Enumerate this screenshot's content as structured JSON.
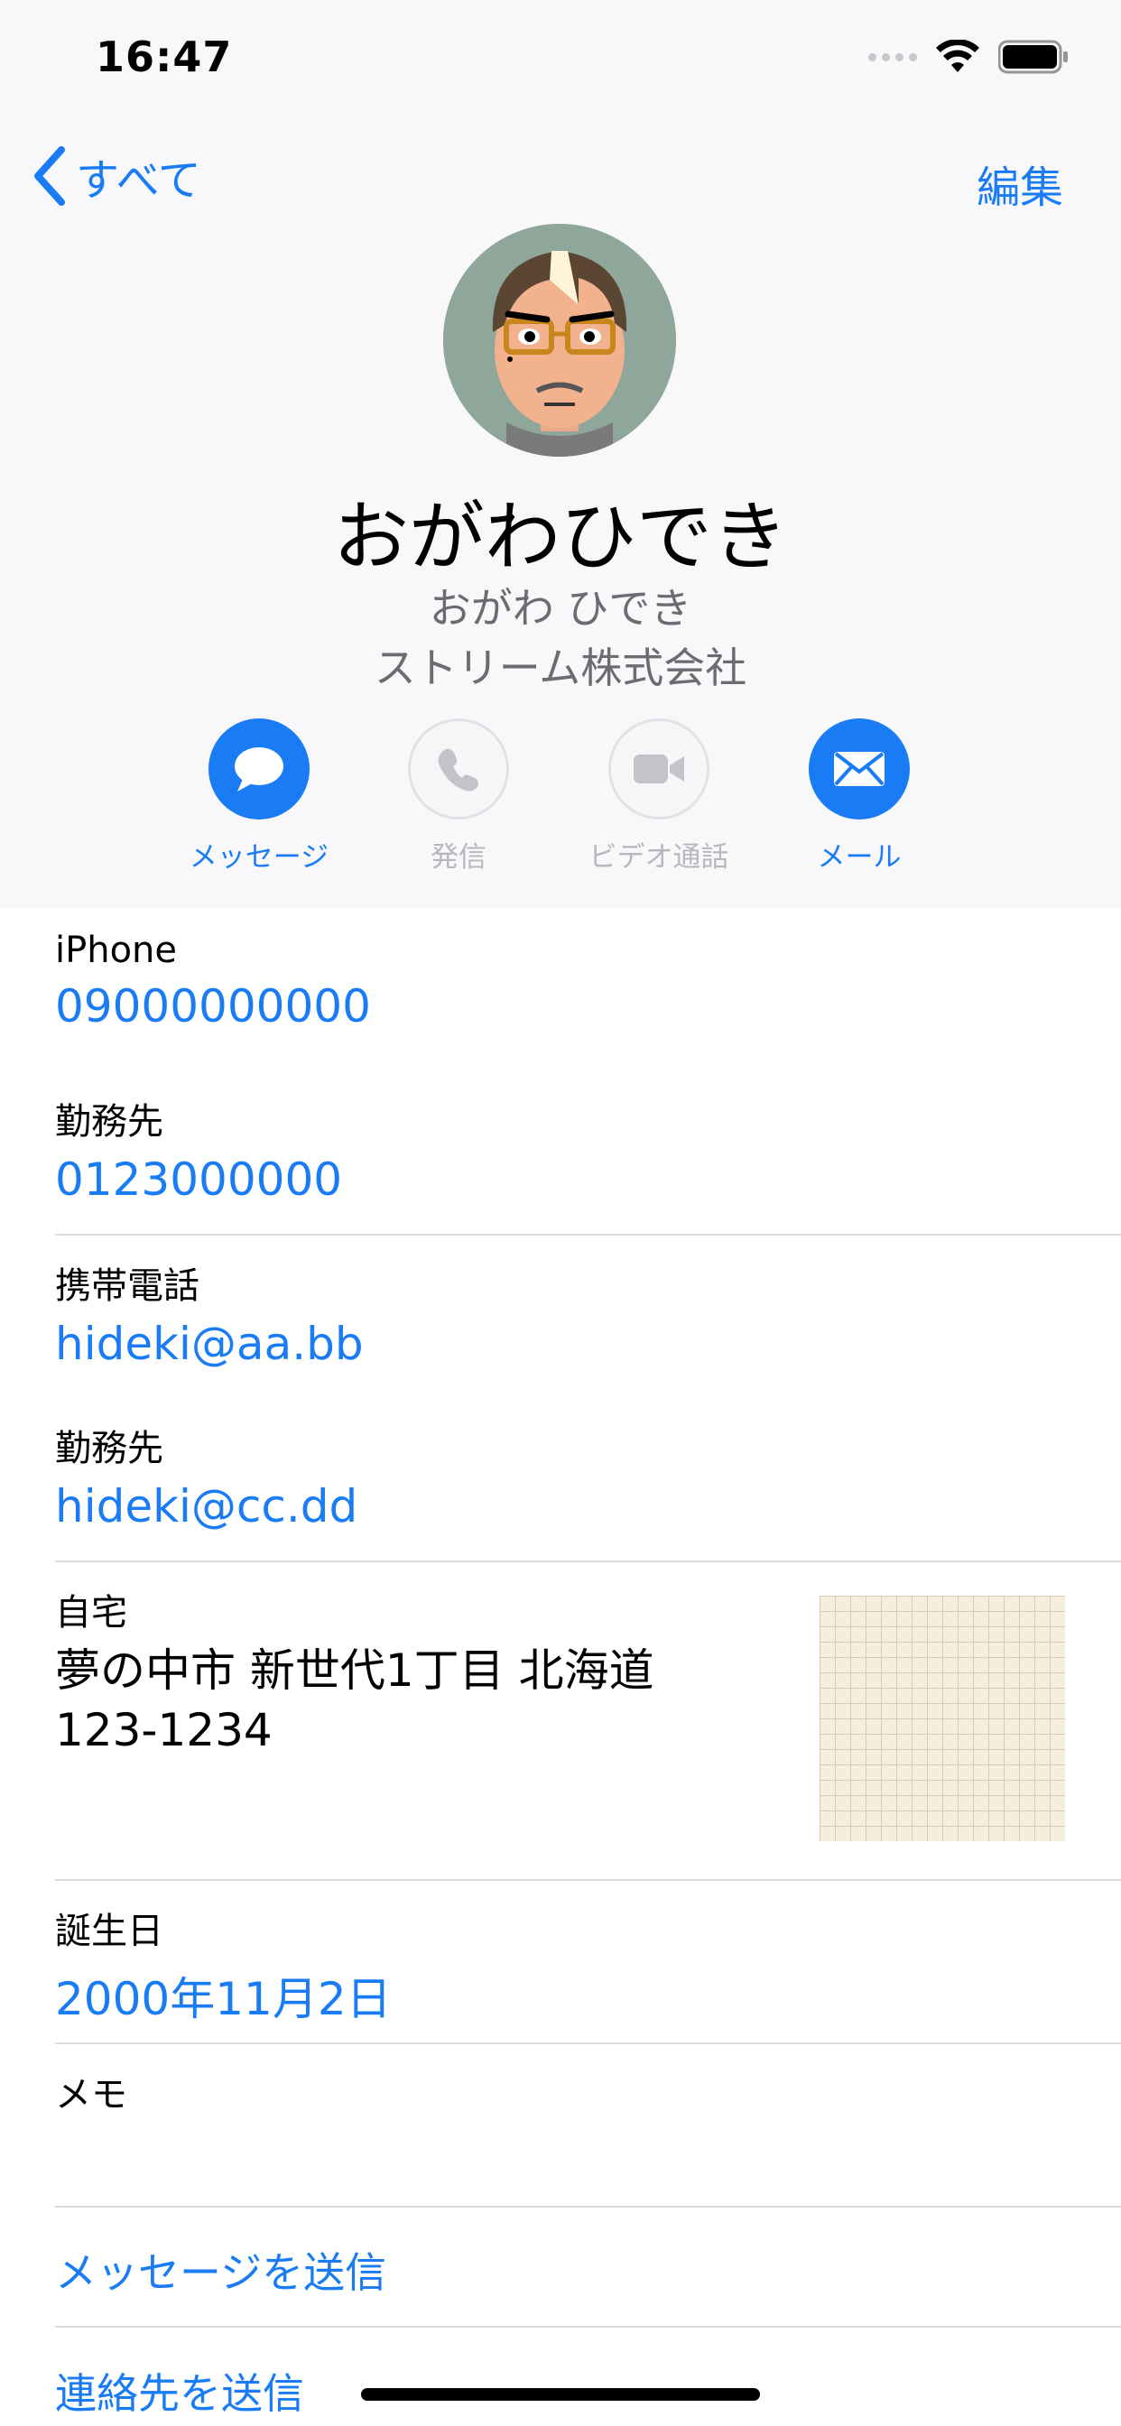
{
  "status_bar": {
    "time": "16:47"
  },
  "nav": {
    "back_label": "すべて",
    "edit_label": "編集"
  },
  "contact": {
    "name": "おがわひでき",
    "phonetic": "おがわ ひでき",
    "company": "ストリーム株式会社"
  },
  "actions": [
    {
      "label": "メッセージ",
      "icon": "message-icon",
      "enabled": true
    },
    {
      "label": "発信",
      "icon": "phone-icon",
      "enabled": false
    },
    {
      "label": "ビデオ通話",
      "icon": "video-icon",
      "enabled": false
    },
    {
      "label": "メール",
      "icon": "mail-icon",
      "enabled": true
    }
  ],
  "phones": [
    {
      "label": "iPhone",
      "value": "09000000000"
    },
    {
      "label": "勤務先",
      "value": "0123000000"
    }
  ],
  "emails": [
    {
      "label": "携帯電話",
      "value": "hideki@aa.bb"
    },
    {
      "label": "勤務先",
      "value": "hideki@cc.dd"
    }
  ],
  "address": {
    "label": "自宅",
    "line1": "夢の中市 新世代1丁目 北海道",
    "line2": "123-1234"
  },
  "birthday": {
    "label": "誕生日",
    "value": "2000年11月2日"
  },
  "notes": {
    "label": "メモ",
    "value": ""
  },
  "links": {
    "send_message": "メッセージを送信",
    "share_contact": "連絡先を送信"
  },
  "colors": {
    "accent": "#1a7cf5",
    "header_bg": "#f8f8fb",
    "separator": "#d9d9de"
  }
}
